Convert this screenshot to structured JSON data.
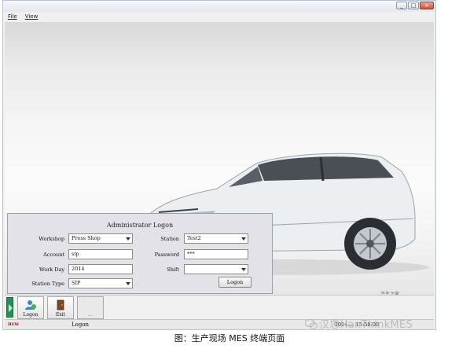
{
  "menu": {
    "file": "File",
    "view": "View"
  },
  "window_buttons": {
    "minimize": "_",
    "maximize": "□",
    "close": "×"
  },
  "logon": {
    "title": "Administrator Logon",
    "workshop_label": "Workshop",
    "workshop_value": "Press Shop",
    "station_label": "Station",
    "station_value": "Test2",
    "account_label": "Account",
    "account_value": "sip",
    "password_label": "Password",
    "password_value": "***",
    "workday_label": "Work Day",
    "workday_value": "2014",
    "shift_label": "Shift",
    "shift_value": "",
    "stationtype_label": "Station Type",
    "stationtype_value": "SIP",
    "logon_button": "Logon"
  },
  "toolbar": {
    "logon": "Logon",
    "exit": "Exit",
    "more": "..."
  },
  "status": {
    "logo": "HEW",
    "mode": "Logon",
    "time": "2014-... 15:58:00"
  },
  "car_watermark": "汽车之家 autohome.com.cn",
  "wechat_watermark": "汉思HanThinkMES",
  "caption": "图：生产现场 MES 终端页面",
  "colors": {
    "panel_bg": "#e2e2e8",
    "window_border": "#b8c3d0"
  }
}
